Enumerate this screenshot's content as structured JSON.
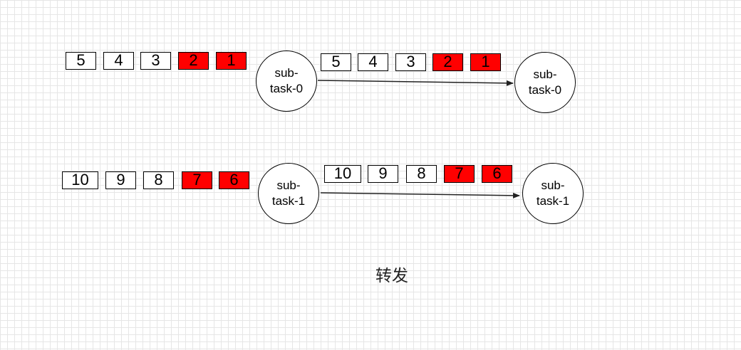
{
  "rows": [
    {
      "source_queue": [
        {
          "label": "5",
          "highlight": false
        },
        {
          "label": "4",
          "highlight": false
        },
        {
          "label": "3",
          "highlight": false
        },
        {
          "label": "2",
          "highlight": true
        },
        {
          "label": "1",
          "highlight": true
        }
      ],
      "source_node": {
        "line1": "sub-",
        "line2": "task-0"
      },
      "target_queue": [
        {
          "label": "5",
          "highlight": false
        },
        {
          "label": "4",
          "highlight": false
        },
        {
          "label": "3",
          "highlight": false
        },
        {
          "label": "2",
          "highlight": true
        },
        {
          "label": "1",
          "highlight": true
        }
      ],
      "target_node": {
        "line1": "sub-",
        "line2": "task-0"
      }
    },
    {
      "source_queue": [
        {
          "label": "10",
          "highlight": false
        },
        {
          "label": "9",
          "highlight": false
        },
        {
          "label": "8",
          "highlight": false
        },
        {
          "label": "7",
          "highlight": true
        },
        {
          "label": "6",
          "highlight": true
        }
      ],
      "source_node": {
        "line1": "sub-",
        "line2": "task-1"
      },
      "target_queue": [
        {
          "label": "10",
          "highlight": false
        },
        {
          "label": "9",
          "highlight": false
        },
        {
          "label": "8",
          "highlight": false
        },
        {
          "label": "7",
          "highlight": true
        },
        {
          "label": "6",
          "highlight": true
        }
      ],
      "target_node": {
        "line1": "sub-",
        "line2": "task-1"
      }
    }
  ],
  "caption": "转发",
  "colors": {
    "highlight": "#ff0000",
    "border": "#000000",
    "background": "#ffffff"
  }
}
